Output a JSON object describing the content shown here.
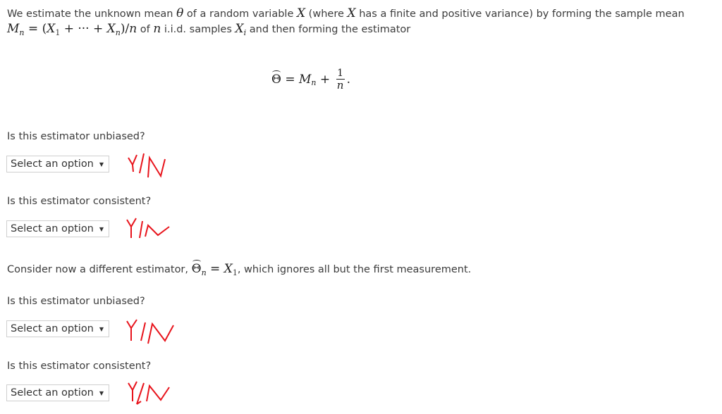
{
  "intro": {
    "line1_part1": "We estimate the unknown mean ",
    "theta": "θ",
    "line1_part2": " of a random variable ",
    "X": "X",
    "line1_part3": " (where ",
    "line1_part4": " has a finite and positive variance) by forming the sample mean",
    "Mn": "M",
    "n": "n",
    "eq1": " = (",
    "X1": "X",
    "one": "1",
    "plus_dots": " + ··· + ",
    "Xn": "X",
    "slash": ")/",
    "line2_part1": " of ",
    "line2_part2": " i.i.d. samples ",
    "Xi": "X",
    "i": "i",
    "line2_part3": " and then forming the estimator"
  },
  "estimator_eq": {
    "theta_hat": "Θ",
    "equals": " = ",
    "M": "M",
    "n": "n",
    "plus": " + ",
    "numerator": "1",
    "denominator": "n",
    "period": "."
  },
  "questions": [
    {
      "label": "Is this estimator unbiased?",
      "select_value": "Select an option",
      "annotation": "Y/N"
    },
    {
      "label": "Is this estimator consistent?",
      "select_value": "Select an option",
      "annotation": "Y/N"
    },
    {
      "label": "Is this estimator unbiased?",
      "select_value": "Select an option",
      "annotation": "Y/N"
    },
    {
      "label": "Is this estimator consistent?",
      "select_value": "Select an option",
      "annotation": "Y/N"
    }
  ],
  "second_estimator": {
    "part1": "Consider now a different estimator, ",
    "theta_hat": "Θ",
    "n": "n",
    "equals": " = ",
    "X": "X",
    "one": "1",
    "part2": ", which ignores all but the first measurement."
  },
  "colors": {
    "annotation": "#e8141c",
    "select_border": "#cfcfcf",
    "text": "#3c3c3c"
  }
}
